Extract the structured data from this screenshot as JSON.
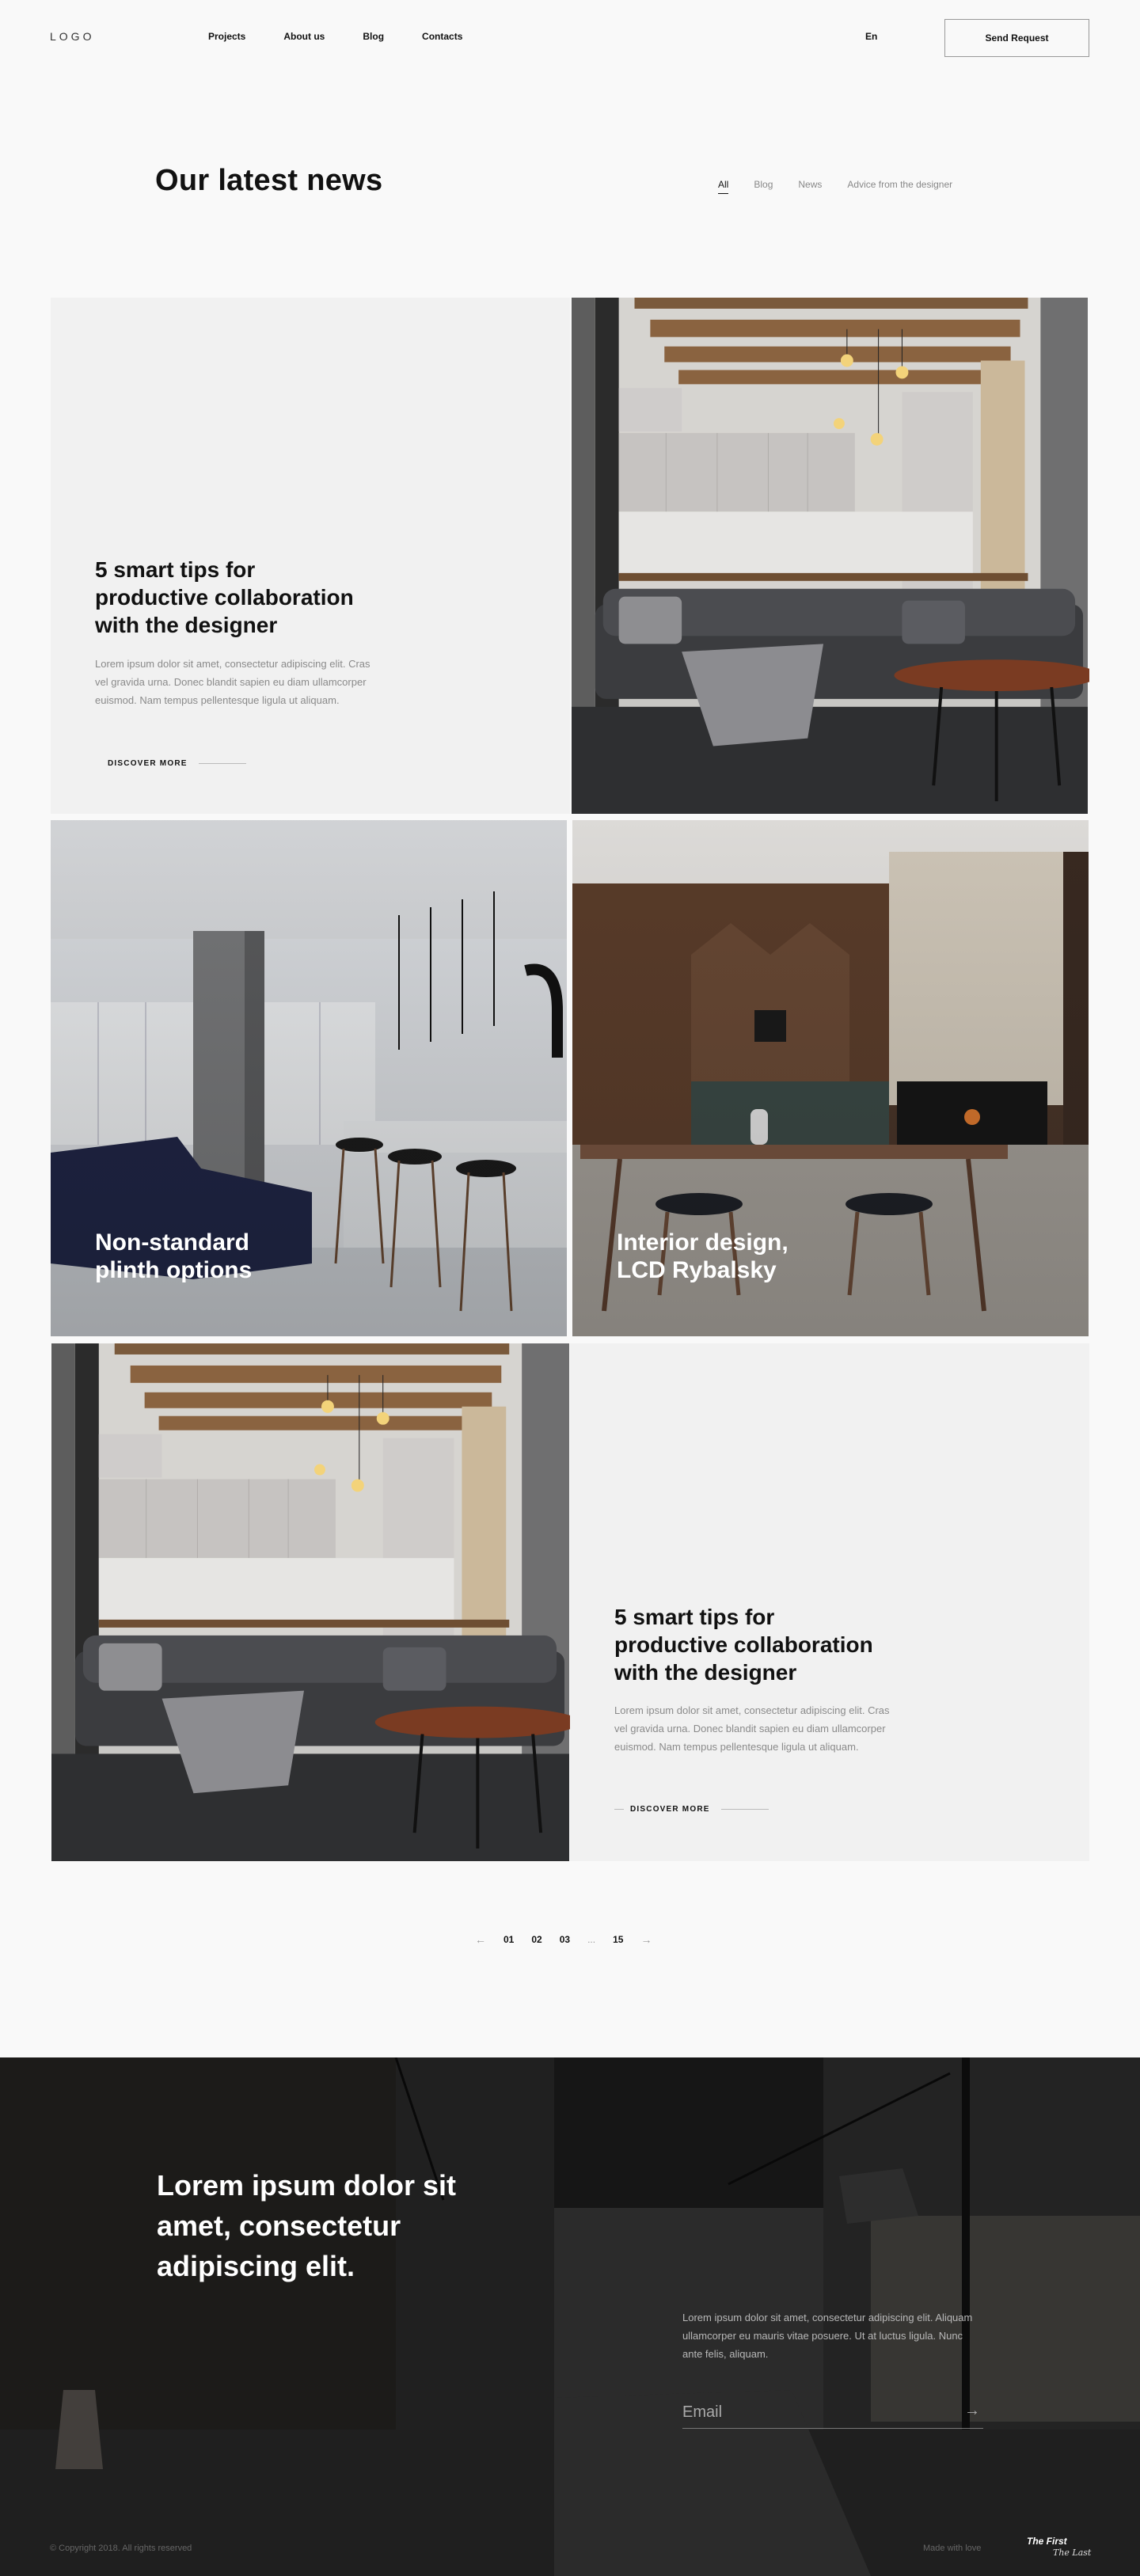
{
  "header": {
    "logo": "LOGO",
    "nav": [
      "Projects",
      "About us",
      "Blog",
      "Contacts"
    ],
    "lang": "En",
    "cta": "Send Request"
  },
  "news": {
    "title": "Our latest news",
    "filters": [
      "All",
      "Blog",
      "News",
      "Advice from the designer"
    ],
    "active_filter": "All"
  },
  "cards": {
    "feature1": {
      "title_lines": [
        "5 smart tips for",
        "productive collaboration",
        "with the designer"
      ],
      "body_lines": [
        "Lorem ipsum dolor sit amet, consectetur adipiscing elit. Cras",
        "vel gravida urna. Donec blandit sapien eu diam ullamcorper",
        "euismod. Nam tempus pellentesque ligula ut aliquam."
      ],
      "link": "DISCOVER MORE"
    },
    "photo1": {
      "title_lines": [
        "Non-standard",
        "plinth options"
      ]
    },
    "photo2": {
      "title_lines": [
        "Interior design,",
        "LCD Rybalsky"
      ]
    },
    "feature2": {
      "title_lines": [
        "5 smart tips for",
        "productive collaboration",
        "with the designer"
      ],
      "body_lines": [
        "Lorem ipsum dolor sit amet, consectetur adipiscing elit. Cras",
        "vel gravida urna. Donec blandit sapien eu diam ullamcorper",
        "euismod. Nam tempus pellentesque ligula ut aliquam."
      ],
      "link": "DISCOVER MORE"
    }
  },
  "pagination": {
    "prev": "←",
    "pages": [
      "01",
      "02",
      "03"
    ],
    "ellipsis": "...",
    "last": "15",
    "next": "→"
  },
  "footer": {
    "headline": "Lorem ipsum dolor sit amet, consectetur adipiscing elit.",
    "text": "Lorem ipsum dolor sit amet, consectetur adipiscing elit. Aliquam ullamcorper eu mauris vitae posuere. Ut at luctus ligula. Nunc ante felis, aliquam.",
    "email_placeholder": "Email",
    "submit_arrow": "→",
    "copyright": "© Copyright 2018. All rights reserved",
    "made_with": "Made with love",
    "brand_line1": "The First",
    "brand_line2": "The Last"
  }
}
